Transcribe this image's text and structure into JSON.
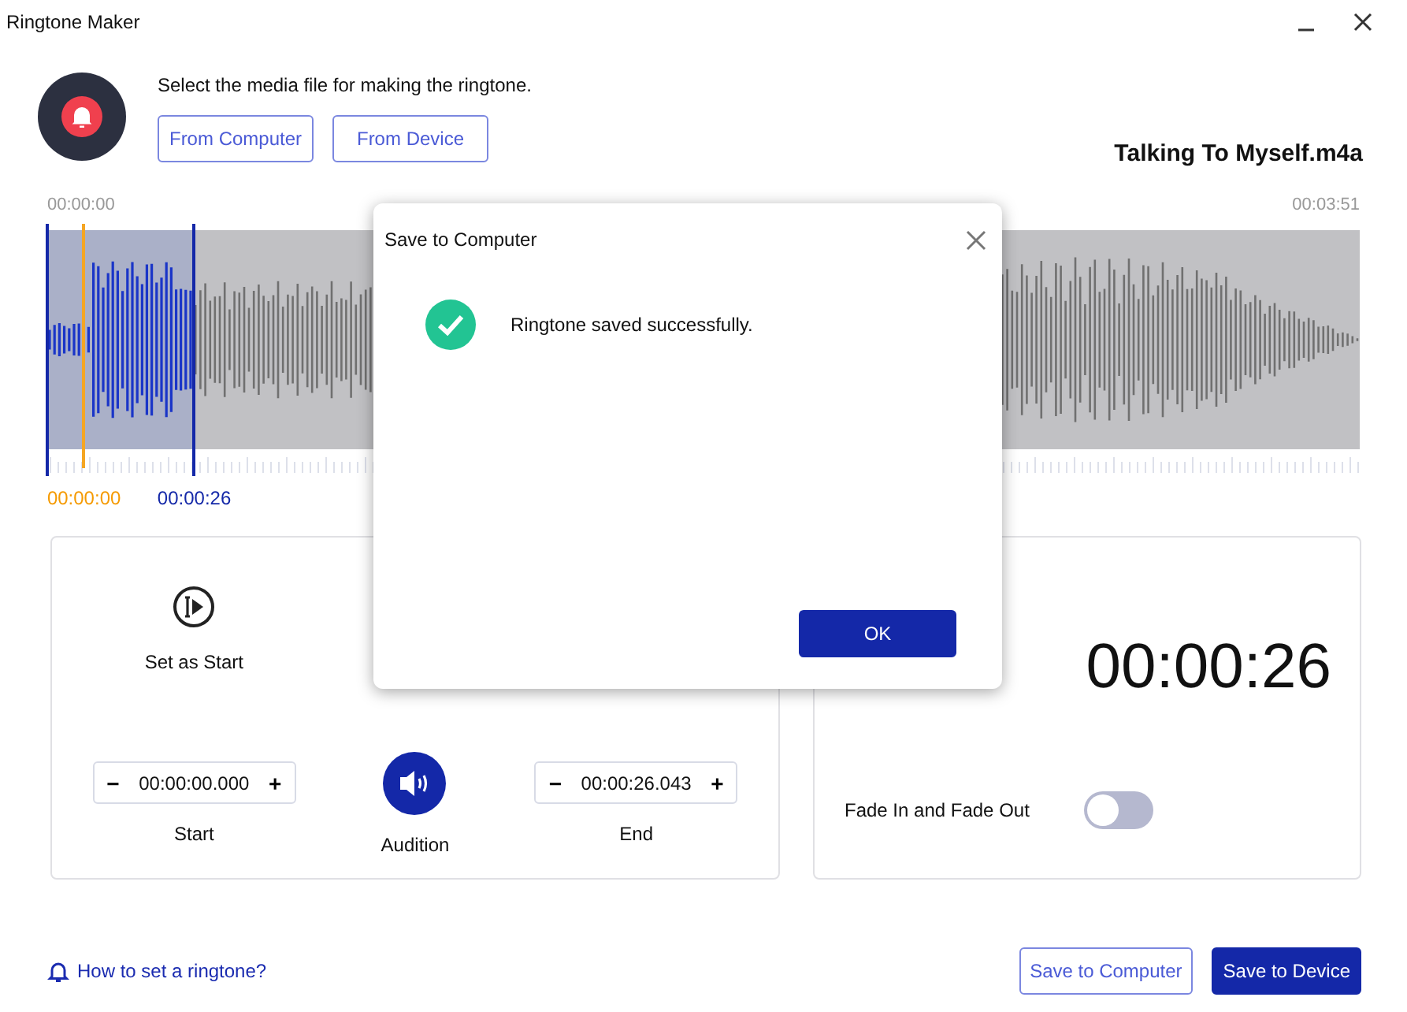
{
  "window": {
    "title": "Ringtone Maker"
  },
  "header": {
    "prompt": "Select the media file for making the ringtone.",
    "buttons": [
      "From Computer",
      "From Device"
    ],
    "file_name": "Talking To Myself.m4a"
  },
  "timeline": {
    "start_time": "00:00:00",
    "end_time": "00:03:51",
    "playhead": {
      "level": 0.028,
      "label": "00:00:00"
    },
    "selection_start": {
      "level": 0
    },
    "selection_end": {
      "level": 0.112,
      "label": "00:00:26"
    }
  },
  "left_panel": {
    "set_start_label": "Set as Start",
    "start": {
      "value": "00:00:00.000",
      "minus": "−",
      "plus": "+",
      "label": "Start"
    },
    "audition_label": "Audition",
    "end": {
      "value": "00:00:26.043",
      "minus": "−",
      "plus": "+",
      "label": "End"
    }
  },
  "right_panel": {
    "duration": "00:00:26",
    "fade": {
      "label": "Fade In and Fade Out",
      "on": false
    }
  },
  "footer": {
    "help_link": "How to set a ringtone?",
    "buttons": [
      {
        "label": "Save to Computer",
        "kind": "outline"
      },
      {
        "label": "Save to Device",
        "kind": "primary"
      }
    ]
  },
  "dialog": {
    "title": "Save to Computer",
    "message": "Ringtone saved successfully.",
    "ok": "OK"
  }
}
